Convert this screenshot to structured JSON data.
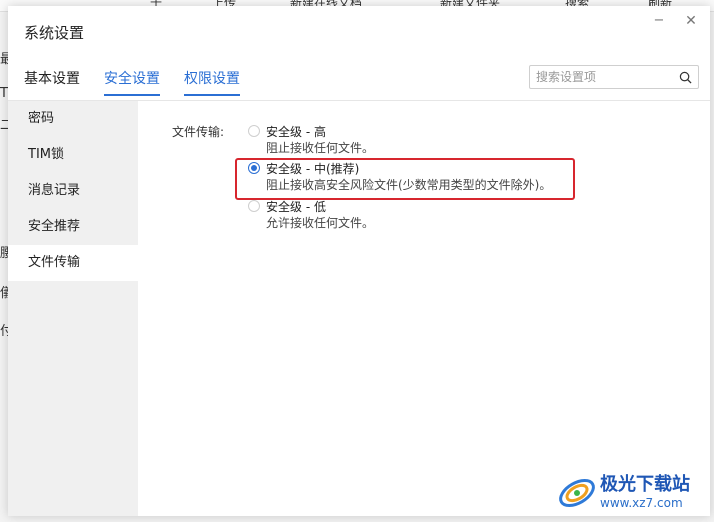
{
  "background_app": {
    "toolbar_items": [
      "十",
      "上传",
      "新建在线文档",
      "新建文件夹",
      "搜索",
      "刷新"
    ],
    "side_glyphs": [
      "最",
      "T",
      "二",
      "腰",
      "儀",
      "付"
    ]
  },
  "dialog": {
    "title": "系统设置",
    "minimize_glyph": "−",
    "close_glyph": "✕"
  },
  "tabs": [
    {
      "label": "基本设置"
    },
    {
      "label": "安全设置"
    },
    {
      "label": "权限设置"
    }
  ],
  "search": {
    "placeholder": "搜索设置项",
    "value": "",
    "icon": "search-icon"
  },
  "nav": {
    "items": [
      {
        "label": "密码"
      },
      {
        "label": "TIM锁"
      },
      {
        "label": "消息记录"
      },
      {
        "label": "安全推荐"
      },
      {
        "label": "文件传输"
      }
    ],
    "active": "文件传输"
  },
  "file_transfer": {
    "label": "文件传输:",
    "options": [
      {
        "title": "安全级 - 高",
        "desc": "阻止接收任何文件。",
        "checked": false
      },
      {
        "title": "安全级 - 中(推荐)",
        "desc": "阻止接收高安全风险文件(少数常用类型的文件除外)。",
        "checked": true
      },
      {
        "title": "安全级 - 低",
        "desc": "允许接收任何文件。",
        "checked": false
      }
    ]
  },
  "colors": {
    "accent": "#2b6fd4",
    "highlight_box": "#d7262e",
    "nav_bg": "#f0f0f0"
  },
  "watermark": {
    "name": "极光下载站",
    "url": "www.xz7.com"
  }
}
